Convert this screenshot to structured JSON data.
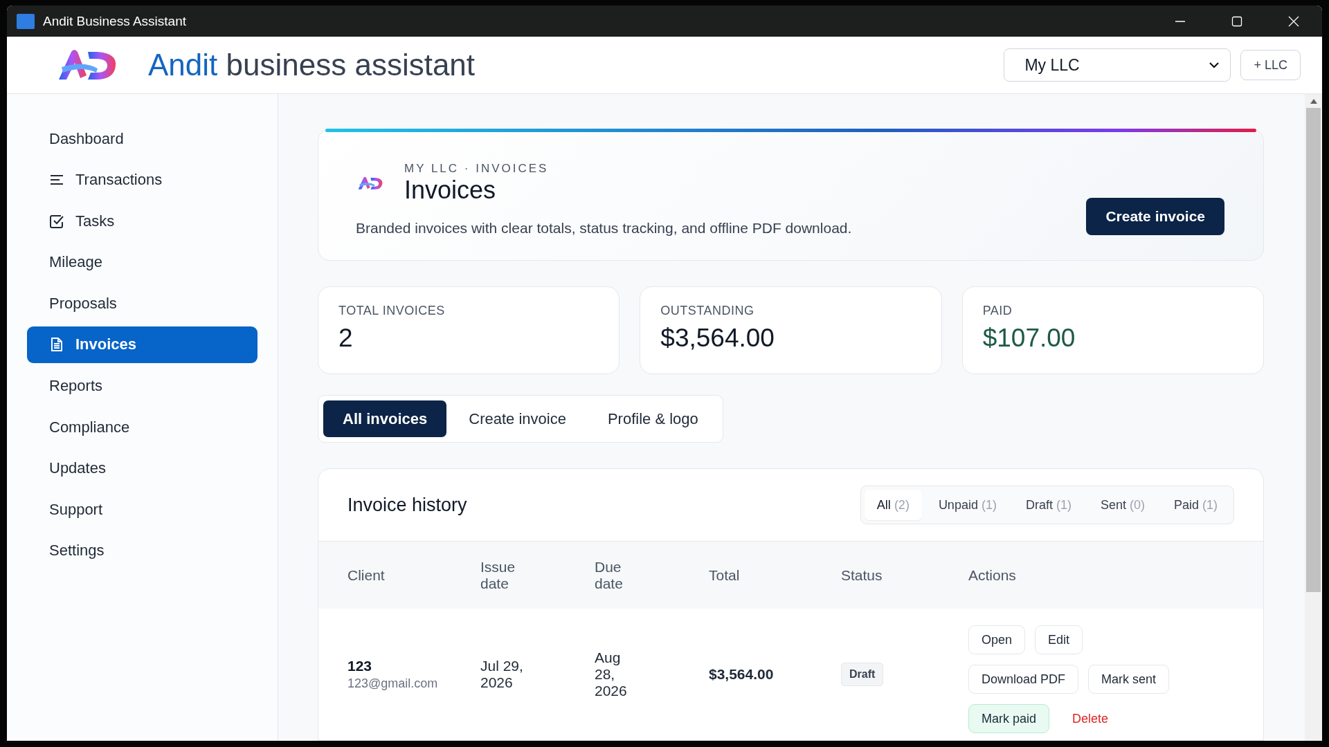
{
  "window": {
    "title": "Andit Business Assistant"
  },
  "header": {
    "brand_accent": "Andit",
    "brand_rest": "business assistant",
    "company_select": {
      "value": "My LLC"
    },
    "add_button": "+ LLC"
  },
  "sidebar": {
    "items": [
      {
        "label": "Dashboard",
        "kind": "plain",
        "selected": false
      },
      {
        "label": "Transactions",
        "kind": "lines",
        "selected": false
      },
      {
        "label": "Tasks",
        "kind": "task",
        "selected": false
      },
      {
        "label": "Mileage",
        "kind": "plain",
        "selected": false
      },
      {
        "label": "Proposals",
        "kind": "plain",
        "selected": false
      },
      {
        "label": "Invoices",
        "kind": "document",
        "selected": true
      },
      {
        "label": "Reports",
        "kind": "plain",
        "selected": false
      },
      {
        "label": "Compliance",
        "kind": "plain",
        "selected": false
      },
      {
        "label": "Updates",
        "kind": "plain",
        "selected": false
      },
      {
        "label": "Support",
        "kind": "plain",
        "selected": false
      },
      {
        "label": "Settings",
        "kind": "plain",
        "selected": false
      }
    ]
  },
  "hero": {
    "eyebrow": "MY LLC · INVOICES",
    "title": "Invoices",
    "description": "Branded invoices with clear totals, status tracking, and offline PDF download.",
    "button": "Create invoice"
  },
  "stats": [
    {
      "label": "TOTAL INVOICES",
      "value": "2",
      "color": "#111827"
    },
    {
      "label": "OUTSTANDING",
      "value": "$3,564.00",
      "color": "#111827"
    },
    {
      "label": "PAID",
      "value": "$107.00",
      "color": "#1e5a44"
    }
  ],
  "tabs": [
    {
      "label": "All invoices",
      "selected": true
    },
    {
      "label": "Create invoice",
      "selected": false
    },
    {
      "label": "Profile & logo",
      "selected": false
    }
  ],
  "history": {
    "title": "Invoice history",
    "filters": [
      {
        "label": "All",
        "count": "(2)",
        "selected": true
      },
      {
        "label": "Unpaid",
        "count": "(1)",
        "selected": false
      },
      {
        "label": "Draft",
        "count": "(1)",
        "selected": false
      },
      {
        "label": "Sent",
        "count": "(0)",
        "selected": false
      },
      {
        "label": "Paid",
        "count": "(1)",
        "selected": false
      }
    ],
    "table": {
      "columns": [
        "Client",
        "Issue date",
        "Due date",
        "Total",
        "Status",
        "Actions"
      ],
      "rows": [
        {
          "client": "123",
          "email": "123@gmail.com",
          "issue_date": "Jul 29, 2026",
          "due_date": "Aug 28, 2026",
          "total": "$3,564.00",
          "status": "Draft",
          "actions": [
            [
              {
                "label": "Open",
                "kind": "default"
              },
              {
                "label": "Edit",
                "kind": "default"
              }
            ],
            [
              {
                "label": "Download PDF",
                "kind": "default"
              },
              {
                "label": "Mark sent",
                "kind": "default"
              }
            ],
            [
              {
                "label": "Mark paid",
                "kind": "success"
              },
              {
                "label": "Delete",
                "kind": "danger"
              }
            ]
          ]
        }
      ]
    }
  }
}
